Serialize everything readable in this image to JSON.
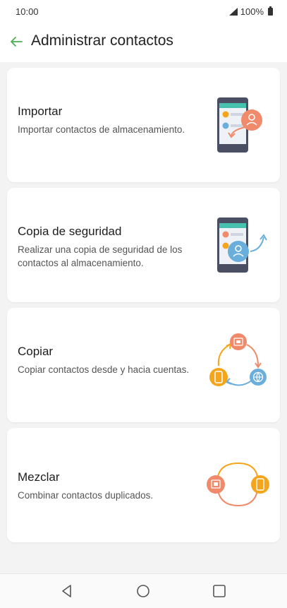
{
  "status": {
    "time": "10:00",
    "battery": "100%"
  },
  "header": {
    "title": "Administrar contactos"
  },
  "cards": [
    {
      "title": "Importar",
      "description": "Importar contactos de almacenamiento."
    },
    {
      "title": "Copia de seguridad",
      "description": "Realizar una copia de seguridad de los contactos al almacenamiento."
    },
    {
      "title": "Copiar",
      "description": "Copiar contactos desde y hacia cuentas."
    },
    {
      "title": "Mezclar",
      "description": "Combinar contactos duplicados."
    }
  ],
  "colors": {
    "accent": "#4caf50",
    "salmon": "#f08a6a",
    "blue": "#6aaedc",
    "yellow": "#f5a51b"
  },
  "icons": [
    "back-arrow-icon",
    "phone-import-icon",
    "phone-backup-icon",
    "copy-cycle-icon",
    "merge-icon",
    "nav-back-icon",
    "nav-home-icon",
    "nav-recents-icon"
  ]
}
